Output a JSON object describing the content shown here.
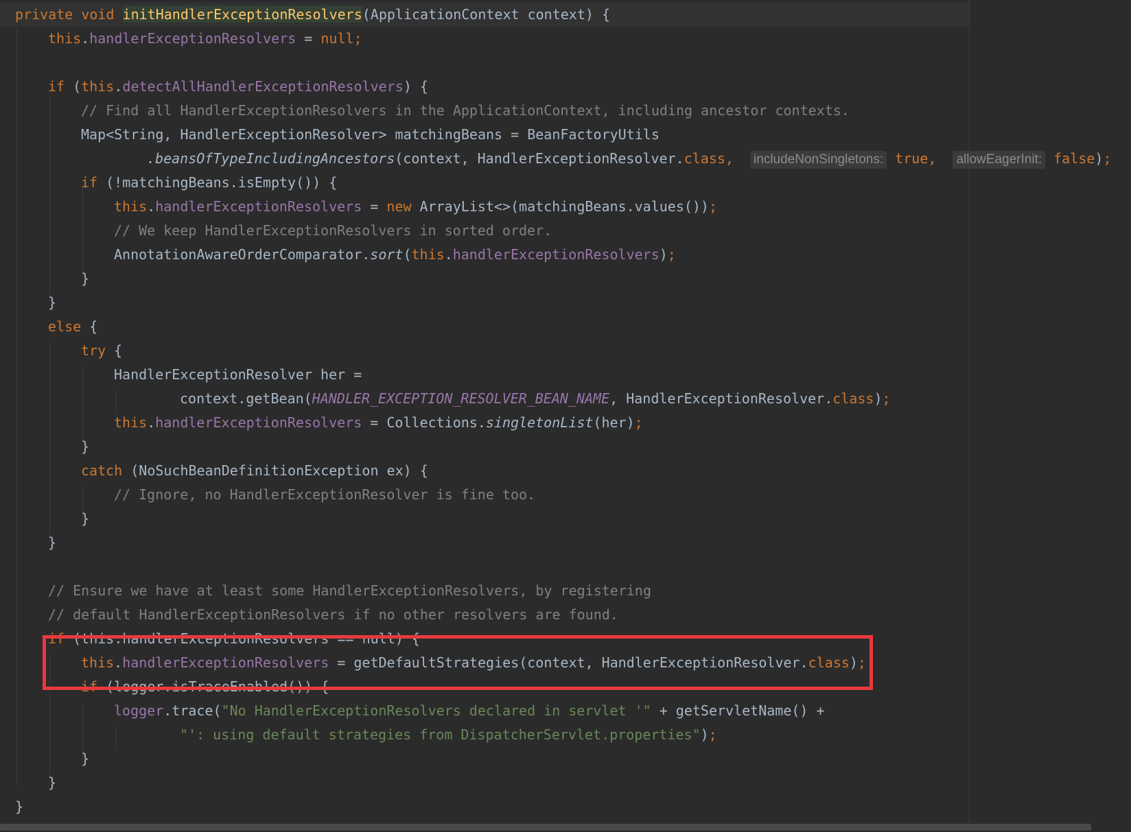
{
  "editor": {
    "language": "Java",
    "theme_colors": {
      "background": "#2b2b2b",
      "keyword": "#cc7832",
      "field": "#9876aa",
      "comment": "#808080",
      "string": "#6a8759",
      "method_declaration": "#ffc66d",
      "text": "#a9b7c6",
      "highlight_box": "#e8393c"
    },
    "code": {
      "l1_mods": "private void ",
      "l1_name": "initHandlerExceptionResolvers",
      "l1_rest": "(ApplicationContext context) {",
      "this": "this",
      "field_her": "handlerExceptionResolvers",
      "field_detect": "detectAllHandlerExceptionResolvers",
      "null_semicolon": "null;",
      "if_kw": "if",
      "else_kw": "else",
      "try_kw": "try",
      "catch_kw": "catch",
      "new_kw": "new",
      "class_kw": "class",
      "true_kw": "true,",
      "false_kw": "false",
      "c1": "// Find all HandlerExceptionResolvers in the ApplicationContext, including ancestor contexts.",
      "l5_text": "Map<String, HandlerExceptionResolver> matchingBeans = BeanFactoryUtils",
      "l6_method": ".beansOfTypeIncludingAncestors",
      "l6_args": "(context, HandlerExceptionResolver.",
      "hint_include": "includeNonSingletons:",
      "hint_eager": "allowEagerInit:",
      "l7_text": "(!matchingBeans.isEmpty()) {",
      "l8_text": " ArrayList<>(matchingBeans.values())",
      "c2": "// We keep HandlerExceptionResolvers in sorted order.",
      "l10_a": "AnnotationAwareOrderComparator.",
      "l10_sort": "sort",
      "l15_text": "HandlerExceptionResolver her =",
      "l16_a": "context.getBean(",
      "l16_const": "HANDLER_EXCEPTION_RESOLVER_BEAN_NAME",
      "l16_b": ", HandlerExceptionResolver.",
      "l17_a": " = Collections.",
      "l17_method": "singletonList",
      "l17_b": "(her)",
      "l19_text": " (NoSuchBeanDefinitionException ex) {",
      "c3": "// Ignore, no HandlerExceptionResolver is fine too.",
      "c4": "// Ensure we have at least some HandlerExceptionResolvers, by registering",
      "c5": "// default HandlerExceptionResolvers if no other resolvers are found.",
      "l26_text": " (this.handlerExceptionResolvers == null) {",
      "l27_text": " = getDefaultStrategies(context, HandlerExceptionResolver.",
      "l28_text": " (logger.isTraceEnabled()) {",
      "l29_a": "logger",
      "l29_b": ".trace(",
      "l29_str": "\"No HandlerExceptionResolvers declared in servlet '\"",
      "l29_c": " + getServletName() +",
      "l30_str": "\"': using default strategies from DispatcherServlet.properties\"",
      "close_paren_semi": ");",
      "semicolon": ";",
      "comma": ",",
      "brace_close": "}",
      "brace_open": " {",
      "paren_open": " ("
    }
  }
}
